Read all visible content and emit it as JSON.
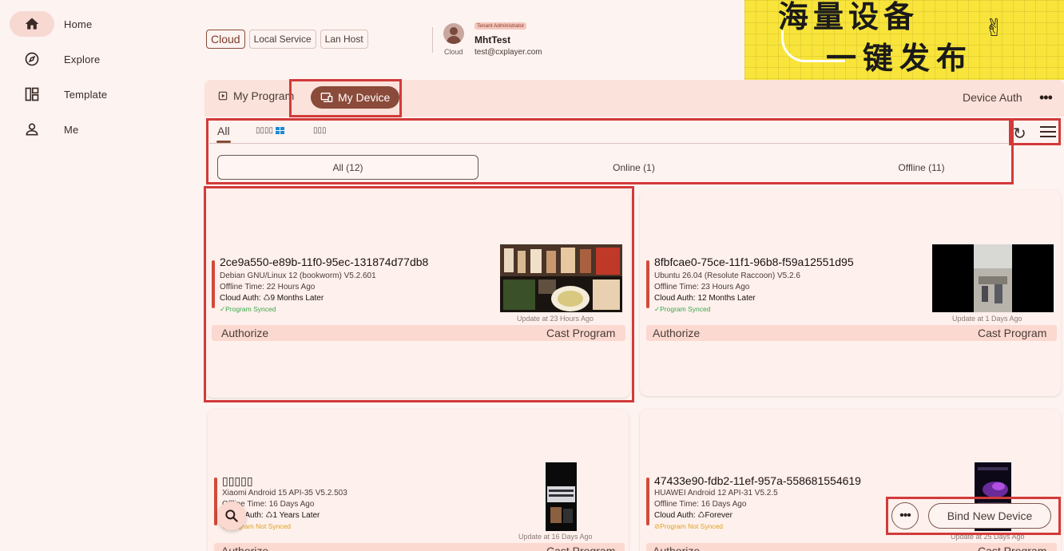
{
  "sidebar": {
    "items": [
      {
        "label": "Home",
        "icon": "home-icon",
        "active": true
      },
      {
        "label": "Explore",
        "icon": "compass-icon"
      },
      {
        "label": "Template",
        "icon": "template-icon"
      },
      {
        "label": "Me",
        "icon": "person-icon"
      }
    ]
  },
  "header": {
    "env_tabs": [
      "Cloud",
      "Local Service",
      "Lan Host"
    ],
    "active_env": "Cloud",
    "user": {
      "role": "Tenant Administrator",
      "name": "MhtTest",
      "email": "test@cxplayer.com",
      "env": "Cloud"
    },
    "banner": {
      "line1": "海量设备",
      "line2": "一键发布"
    }
  },
  "main": {
    "tabs": [
      {
        "label": "My Program",
        "active": false
      },
      {
        "label": "My Device",
        "active": true
      }
    ],
    "device_auth": "Device Auth",
    "filter_tabs": [
      "All",
      "▯▯▯▯",
      "▯▯▯"
    ],
    "segments": [
      "All (12)",
      "Online (1)",
      "Offline (11)"
    ],
    "devices": [
      {
        "id": "2ce9a550-e89b-11f0-95ec-131874d77db8",
        "os": "Debian GNU/Linux 12 (bookworm) V5.2.601",
        "offline": "Offline Time: 22 Hours Ago",
        "auth": "Cloud Auth: ♺9 Months Later",
        "sync": "✓Program Synced",
        "synced": true,
        "update": "Update at 23 Hours Ago",
        "authorize": "Authorize",
        "cast": "Cast Program"
      },
      {
        "id": "8fbfcae0-75ce-11f1-96b8-f59a12551d95",
        "os": "Ubuntu 26.04 (Resolute Raccoon) V5.2.6",
        "offline": "Offline Time: 23 Hours Ago",
        "auth": "Cloud Auth: 12 Months Later",
        "sync": "✓Program Synced",
        "synced": true,
        "update": "Update at 1 Days Ago",
        "authorize": "Authorize",
        "cast": "Cast Program"
      },
      {
        "id": "▯▯▯▯▯",
        "os": "Xiaomi Android 15 API-35 V5.2.503",
        "offline": "Offline Time: 16 Days Ago",
        "auth": "Cloud Auth: ♺1 Years Later",
        "sync": "⊘Program Not Synced",
        "synced": false,
        "update": "Update at 16 Days Ago",
        "authorize": "Authorize",
        "cast": "Cast Program"
      },
      {
        "id": "47433e90-fdb2-11ef-957a-558681554619",
        "os": "HUAWEI Android 12 API-31 V5.2.5",
        "offline": "Offline Time: 16 Days Ago",
        "auth": "Cloud Auth: ♺Forever",
        "sync": "⊘Program Not Synced",
        "synced": false,
        "update": "Update at 25 Days Ago",
        "authorize": "Authorize",
        "cast": "Cast Program"
      }
    ],
    "bind_button": "Bind New Device"
  },
  "colors": {
    "accent": "#8a4b3a",
    "background": "#fdf3f0",
    "highlight": "#d23a3a",
    "synced": "#3aa84a",
    "not_synced": "#e0a020"
  }
}
